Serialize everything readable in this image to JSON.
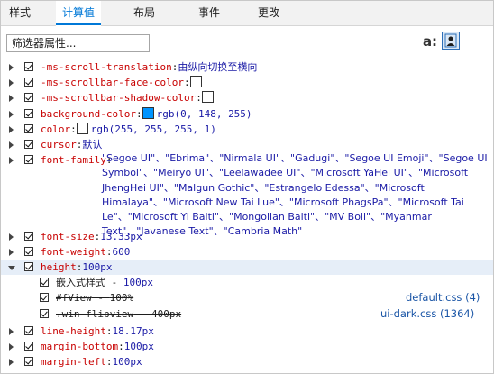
{
  "tabs": [
    "样式",
    "计算值",
    "布局",
    "事件",
    "更改"
  ],
  "active_tab": "计算值",
  "filter": {
    "placeholder": "筛选器属性..."
  },
  "toolbar": {
    "toggle_label": "a:"
  },
  "properties": [
    {
      "name": "-ms-scroll-translation",
      "value": "由纵向切换至横向"
    },
    {
      "name": "-ms-scrollbar-face-color",
      "value": "",
      "swatch": "#ffffff"
    },
    {
      "name": "-ms-scrollbar-shadow-color",
      "value": "",
      "swatch": "#ffffff"
    },
    {
      "name": "background-color",
      "value": "rgb(0, 148, 255)",
      "swatch": "#0094ff"
    },
    {
      "name": "color",
      "value": "rgb(255, 255, 255, 1)",
      "swatch": "#ffffff"
    },
    {
      "name": "cursor",
      "value": "默认"
    },
    {
      "name": "font-family",
      "value": "\"Segoe UI\"、\"Ebrima\"、\"Nirmala UI\"、\"Gadugi\"、\"Segoe UI Emoji\"、\"Segoe UI Symbol\"、\"Meiryo UI\"、\"Leelawadee UI\"、\"Microsoft YaHei UI\"、\"Microsoft JhengHei UI\"、\"Malgun Gothic\"、\"Estrangelo Edessa\"、\"Microsoft Himalaya\"、\"Microsoft New Tai Lue\"、\"Microsoft PhagsPa\"、\"Microsoft Tai Le\"、\"Microsoft Yi Baiti\"、\"Mongolian Baiti\"、\"MV Boli\"、\"Myanmar Text\"、\"Javanese Text\"、\"Cambria Math\""
    },
    {
      "name": "font-size",
      "value": "13.33px"
    },
    {
      "name": "font-weight",
      "value": "600"
    },
    {
      "name": "height",
      "value": "100px"
    },
    {
      "name": "line-height",
      "value": "18.17px"
    },
    {
      "name": "margin-bottom",
      "value": "100px"
    },
    {
      "name": "margin-left",
      "value": "100px"
    }
  ],
  "height_rules": [
    {
      "selector": "嵌入式样式",
      "value": "100px",
      "struck": false,
      "source": ""
    },
    {
      "selector": "#fView",
      "value": "100%",
      "struck": true,
      "source": "default.css (4)"
    },
    {
      "selector": ".win-flipview",
      "value": "400px",
      "struck": true,
      "source": "ui-dark.css (1364)"
    }
  ],
  "colors": {
    "accent": "#0078d7",
    "property_name": "#c80000",
    "property_value": "#1a1aa6"
  }
}
